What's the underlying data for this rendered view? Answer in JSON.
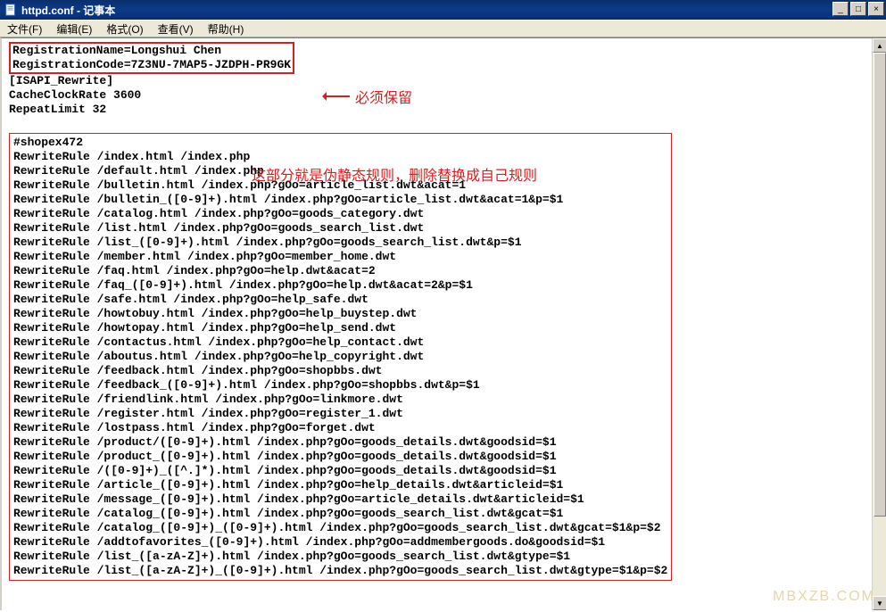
{
  "window": {
    "title": "httpd.conf - 记事本"
  },
  "menu": {
    "file": "文件(F)",
    "edit": "编辑(E)",
    "format": "格式(O)",
    "view": "查看(V)",
    "help": "帮助(H)"
  },
  "registration": {
    "line1": "RegistrationName=Longshui Chen",
    "line2": "RegistrationCode=7Z3NU-7MAP5-JZDPH-PR9GK"
  },
  "config_header": {
    "line1": "[ISAPI_Rewrite]",
    "line2": "CacheClockRate 3600",
    "line3": "RepeatLimit 32"
  },
  "rules_block": "#shopex472\nRewriteRule /index.html /index.php\nRewriteRule /default.html /index.php\nRewriteRule /bulletin.html /index.php?gOo=article_list.dwt&acat=1\nRewriteRule /bulletin_([0-9]+).html /index.php?gOo=article_list.dwt&acat=1&p=$1\nRewriteRule /catalog.html /index.php?gOo=goods_category.dwt\nRewriteRule /list.html /index.php?gOo=goods_search_list.dwt\nRewriteRule /list_([0-9]+).html /index.php?gOo=goods_search_list.dwt&p=$1\nRewriteRule /member.html /index.php?gOo=member_home.dwt\nRewriteRule /faq.html /index.php?gOo=help.dwt&acat=2\nRewriteRule /faq_([0-9]+).html /index.php?gOo=help.dwt&acat=2&p=$1\nRewriteRule /safe.html /index.php?gOo=help_safe.dwt\nRewriteRule /howtobuy.html /index.php?gOo=help_buystep.dwt\nRewriteRule /howtopay.html /index.php?gOo=help_send.dwt\nRewriteRule /contactus.html /index.php?gOo=help_contact.dwt\nRewriteRule /aboutus.html /index.php?gOo=help_copyright.dwt\nRewriteRule /feedback.html /index.php?gOo=shopbbs.dwt\nRewriteRule /feedback_([0-9]+).html /index.php?gOo=shopbbs.dwt&p=$1\nRewriteRule /friendlink.html /index.php?gOo=linkmore.dwt\nRewriteRule /register.html /index.php?gOo=register_1.dwt\nRewriteRule /lostpass.html /index.php?gOo=forget.dwt\nRewriteRule /product/([0-9]+).html /index.php?gOo=goods_details.dwt&goodsid=$1\nRewriteRule /product_([0-9]+).html /index.php?gOo=goods_details.dwt&goodsid=$1\nRewriteRule /([0-9]+)_([^.]*).html /index.php?gOo=goods_details.dwt&goodsid=$1\nRewriteRule /article_([0-9]+).html /index.php?gOo=help_details.dwt&articleid=$1\nRewriteRule /message_([0-9]+).html /index.php?gOo=article_details.dwt&articleid=$1\nRewriteRule /catalog_([0-9]+).html /index.php?gOo=goods_search_list.dwt&gcat=$1\nRewriteRule /catalog_([0-9]+)_([0-9]+).html /index.php?gOo=goods_search_list.dwt&gcat=$1&p=$2\nRewriteRule /addtofavorites_([0-9]+).html /index.php?gOo=addmembergoods.do&goodsid=$1\nRewriteRule /list_([a-zA-Z]+).html /index.php?gOo=goods_search_list.dwt&gtype=$1\nRewriteRule /list_([a-zA-Z]+)_([0-9]+).html /index.php?gOo=goods_search_list.dwt&gtype=$1&p=$2",
  "annotations": {
    "must_keep": "必须保留",
    "rules_desc": "这部分就是伪静态规则，删除替换成自己规则"
  },
  "watermark": "MBXZB.COM",
  "winbuttons": {
    "minimize": "_",
    "maximize": "□",
    "close": "×"
  }
}
